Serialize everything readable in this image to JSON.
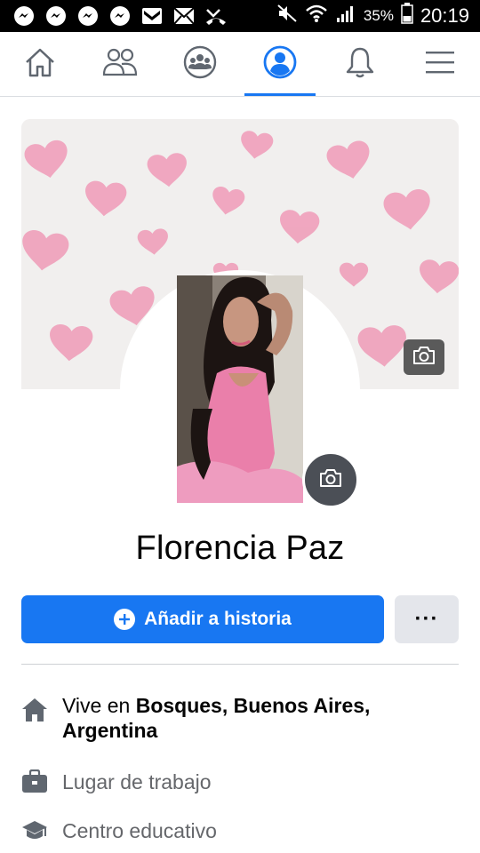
{
  "status_bar": {
    "battery": "35%",
    "time": "20:19",
    "notification_icons": [
      "messenger-icon",
      "messenger-icon",
      "messenger-icon",
      "messenger-icon",
      "gmail-icon",
      "email-icon",
      "missed-call-icon"
    ]
  },
  "nav": {
    "tabs": [
      "home-icon",
      "friends-icon",
      "groups-icon",
      "profile-icon",
      "notifications-icon",
      "menu-icon"
    ],
    "active_tab": "profile-icon",
    "accent_color": "#1877f2"
  },
  "profile": {
    "name": "Florencia Paz"
  },
  "actions": {
    "add_story_label": "Añadir a historia",
    "more_label": "···"
  },
  "intro": {
    "lives_prefix": "Vive en ",
    "lives_place": "Bosques, Buenos Aires, Argentina",
    "workplace": "Lugar de trabajo",
    "education": "Centro educativo"
  }
}
